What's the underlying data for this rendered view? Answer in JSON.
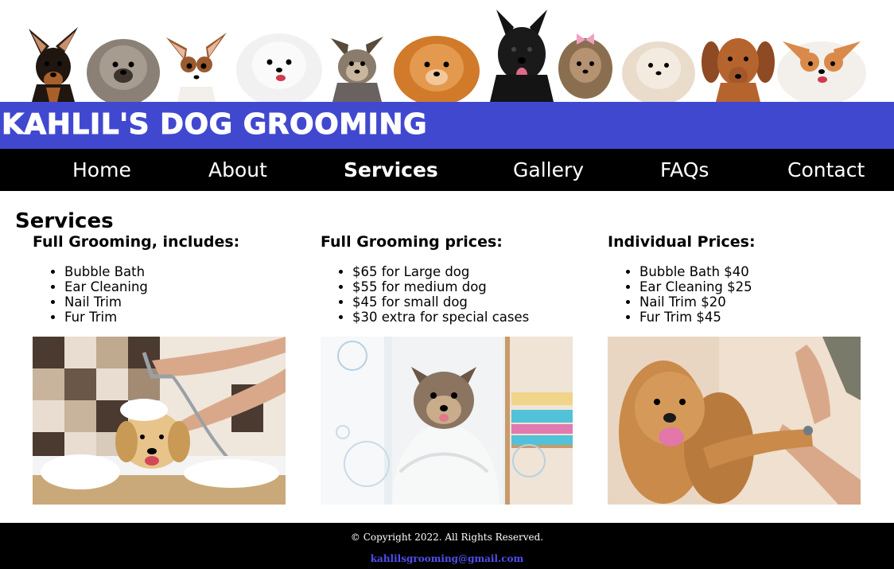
{
  "header": {
    "site_title": "Kahlil's Dog Grooming",
    "dogs": [
      "dog-doberman-pinscher",
      "dog-pomeranian-grey",
      "dog-chihuahua",
      "dog-pomeranian-white",
      "dog-yorkie",
      "dog-pomeranian-orange",
      "dog-scottish-terrier",
      "dog-yorkie-bow",
      "dog-pomeranian-cream",
      "dog-dachshund",
      "dog-papillon"
    ],
    "brand_color": "#4148d0"
  },
  "nav": {
    "items": [
      {
        "label": "Home",
        "active": false
      },
      {
        "label": "About",
        "active": false
      },
      {
        "label": "Services",
        "active": true
      },
      {
        "label": "Gallery",
        "active": false
      },
      {
        "label": "FAQs",
        "active": false
      },
      {
        "label": "Contact",
        "active": false
      }
    ]
  },
  "main": {
    "title": "Services",
    "columns": [
      {
        "heading": "Full Grooming, includes:",
        "items": [
          "Bubble Bath",
          "Ear Cleaning",
          "Nail Trim",
          "Fur Trim"
        ],
        "photo": "dog-bath-photo"
      },
      {
        "heading": "Full Grooming prices:",
        "items": [
          "$65 for Large dog",
          "$55 for medium dog",
          "$45 for small dog",
          "$30 extra for special cases"
        ],
        "photo": "yorkie-towel-photo"
      },
      {
        "heading": "Individual Prices:",
        "items": [
          "Bubble Bath $40",
          "Ear Cleaning $25",
          "Nail Trim $20",
          "Fur Trim $45"
        ],
        "photo": "spaniel-nail-trim-photo"
      }
    ]
  },
  "footer": {
    "copyright": "© Copyright 2022. All Rights Reserved.",
    "email": "kahlilsgrooming@gmail.com"
  }
}
